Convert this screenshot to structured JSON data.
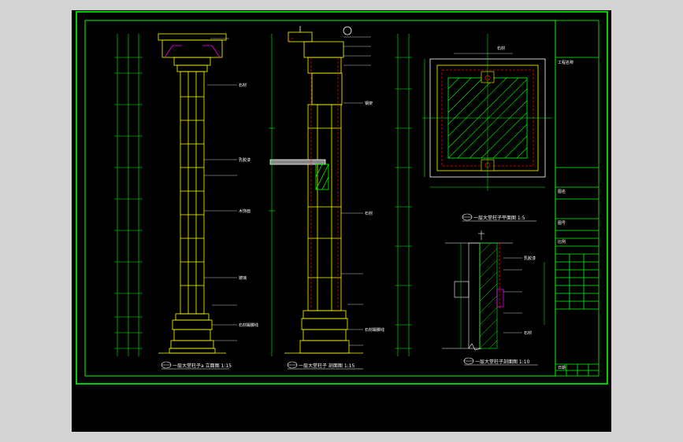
{
  "captions": {
    "elevation_a": "一层大堂柱子a 立面图  1:15",
    "elevation_b": "一层大堂柱子 剖面图  1:15",
    "plan": "一层大堂柱子平面图  1:5",
    "detail": "一层大堂柱子剖面图  1:10"
  },
  "labels": {
    "stone": "石材",
    "paint": "乳胶漆",
    "steel": "钢架",
    "wood": "木饰面",
    "glass": "玻璃",
    "base": "石材踢脚线"
  },
  "title_block": {
    "project": "工程名称",
    "drawing": "图名",
    "number": "图号",
    "scale": "比例",
    "date": "日期"
  },
  "colors": {
    "background": "#000000",
    "frame": "#00ff00",
    "lines": "#ffff00",
    "section": "#ff0000",
    "text": "#ffffff",
    "accent": "#ff00ff",
    "outer": "#d4d4d4"
  }
}
